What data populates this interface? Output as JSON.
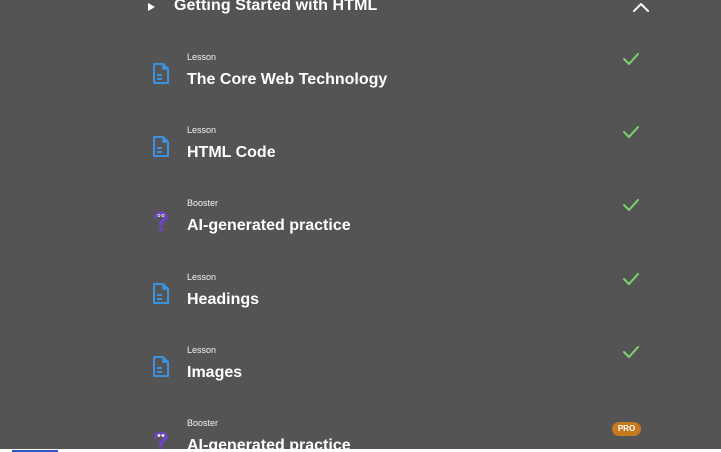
{
  "section": {
    "title": "Getting Started with HTML",
    "expand_icon": "play-icon",
    "collapse_icon": "chevron-up-icon"
  },
  "items": [
    {
      "type": "Lesson",
      "title": "The Core Web Technology",
      "icon": "document-icon",
      "status": "completed"
    },
    {
      "type": "Lesson",
      "title": "HTML Code",
      "icon": "document-icon",
      "status": "completed"
    },
    {
      "type": "Booster",
      "title": "AI-generated practice",
      "icon": "question-mascot-icon",
      "status": "completed"
    },
    {
      "type": "Lesson",
      "title": "Headings",
      "icon": "document-icon",
      "status": "completed"
    },
    {
      "type": "Lesson",
      "title": "Images",
      "icon": "document-icon",
      "status": "completed"
    },
    {
      "type": "Booster",
      "title": "AI-generated practice",
      "icon": "question-mascot-icon",
      "status": "pro",
      "badge": "PRO"
    }
  ],
  "colors": {
    "background": "#545454",
    "text": "#ffffff",
    "check": "#7bd36b",
    "lesson_icon": "#3b93e0",
    "booster_icon": "#6d44c4",
    "pro_badge": "#c8791e"
  }
}
